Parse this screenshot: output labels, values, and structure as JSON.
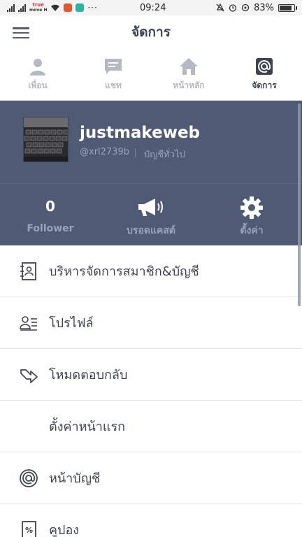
{
  "status_bar": {
    "carrier_top": "true",
    "carrier_bottom": "move H",
    "time": "09:24",
    "battery": "83%"
  },
  "app_bar": {
    "title": "จัดการ"
  },
  "tabs": [
    {
      "label": "เพื่อน",
      "icon": "person-icon"
    },
    {
      "label": "แชท",
      "icon": "chat-icon"
    },
    {
      "label": "หน้าหลัก",
      "icon": "home-icon"
    },
    {
      "label": "จัดการ",
      "icon": "at-icon",
      "active": true
    }
  ],
  "account": {
    "name": "justmakeweb",
    "id": "@xrl2739b",
    "type": "บัญชีทั่วไป"
  },
  "stats": [
    {
      "value": "0",
      "label": "Follower"
    },
    {
      "label": "บรอดแคสต์",
      "icon": "megaphone-icon"
    },
    {
      "label": "ตั้งค่า",
      "icon": "gear-icon"
    }
  ],
  "menu": [
    {
      "label": "บริหารจัดการสมาชิก&บัญชี",
      "icon": "contact-book-icon"
    },
    {
      "label": "โปรไฟล์",
      "icon": "profile-card-icon"
    },
    {
      "label": "โหมดตอบกลับ",
      "icon": "reply-arrow-icon"
    },
    {
      "label": "ตั้งค่าหน้าแรก",
      "icon": ""
    },
    {
      "label": "หน้าบัญชี",
      "icon": "at-circle-icon"
    },
    {
      "label": "คูปอง",
      "icon": "coupon-icon"
    }
  ],
  "colors": {
    "header_bg": "#4f5a75",
    "text_dark": "#3c4454",
    "text_muted": "#9aa2b8",
    "tab_inactive": "#b5b9c4"
  }
}
